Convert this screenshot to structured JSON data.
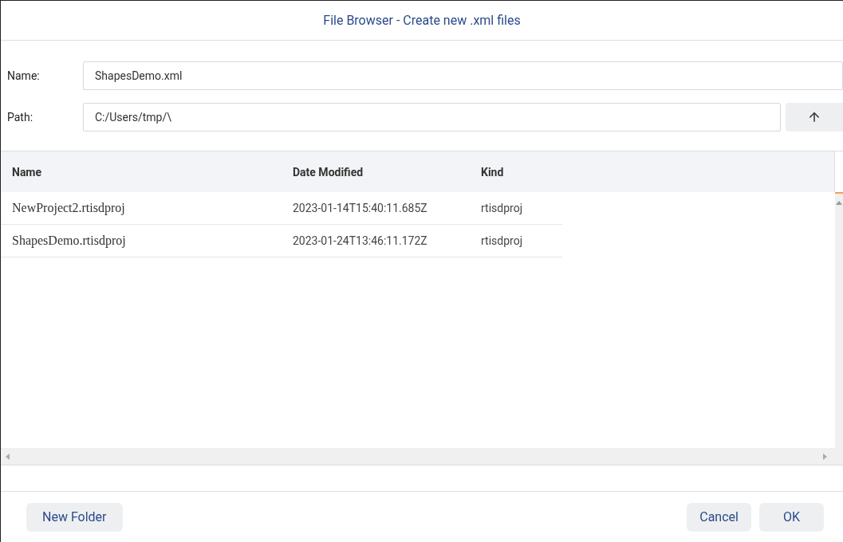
{
  "window": {
    "title": "File Browser - Create new .xml files"
  },
  "fields": [
    {
      "label": "Name:",
      "value": "ShapesDemo.xml",
      "kind": "text"
    },
    {
      "label": "Path:",
      "value": "C:/Users/tmp/\\",
      "kind": "path"
    }
  ],
  "table": {
    "columns": [
      "Name",
      "Date Modified",
      "Kind"
    ],
    "rows": [
      {
        "name": "NewProject2.rtisdproj",
        "date": "2023-01-14T15:40:11.685Z",
        "kind": "rtisdproj"
      },
      {
        "name": "ShapesDemo.rtisdproj",
        "date": "2023-01-24T13:46:11.172Z",
        "kind": "rtisdproj"
      }
    ]
  },
  "buttons": {
    "left": [
      "New Folder"
    ],
    "right": [
      "Cancel",
      "OK"
    ]
  }
}
